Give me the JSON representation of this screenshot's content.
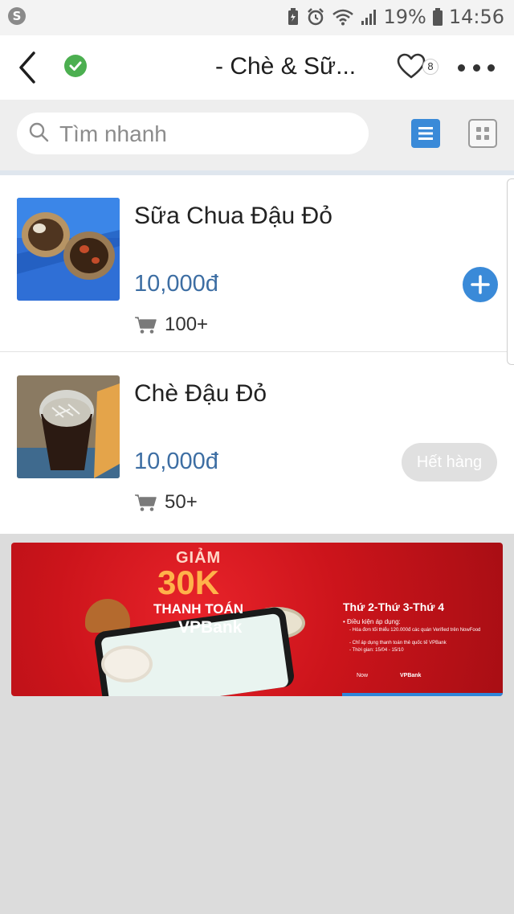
{
  "status_bar": {
    "app_icon": "S",
    "battery_percent": "19%",
    "time": "14:56"
  },
  "header": {
    "title": "- Chè & Sữ...",
    "favorite_count": "8"
  },
  "search": {
    "placeholder": "Tìm nhanh"
  },
  "products": [
    {
      "name": "Sữa Chua Đậu Đỏ",
      "price": "10,000đ",
      "sold": "100+"
    },
    {
      "name": "Chè Đậu Đỏ",
      "price": "10,000đ",
      "sold": "50+",
      "status_label": "Hết hàng"
    }
  ],
  "banner": {
    "giam": "GIẢM",
    "amount": "30K",
    "thanh_toan": "THANH TOÁN",
    "vpbank": "VPBank",
    "days": "Thứ 2-Thứ 3-Thứ 4",
    "cond_title": "• Điều kiện áp dụng:",
    "cond_1": "- Hóa đơn tối thiểu 120.000đ các quán Verified trên NowFood",
    "cond_2": "- Chỉ áp dụng thanh toán thẻ quốc tế VPBank",
    "cond_3": "- Thời gian: 15/04 - 15/10",
    "logo_now": "Now",
    "logo_vpbank": "VPBank"
  },
  "colors": {
    "accent_blue": "#3a8ad8",
    "price_blue": "#3d6ea3",
    "verified_green": "#4caf50",
    "banner_red": "#cc141b"
  },
  "icons": {
    "back": "back-arrow-icon",
    "verified": "verified-check-icon",
    "favorite": "heart-icon",
    "more": "more-dots-icon",
    "search": "search-icon",
    "list_view": "list-view-icon",
    "grid_view": "grid-view-icon",
    "cart": "cart-icon",
    "add": "plus-icon"
  }
}
